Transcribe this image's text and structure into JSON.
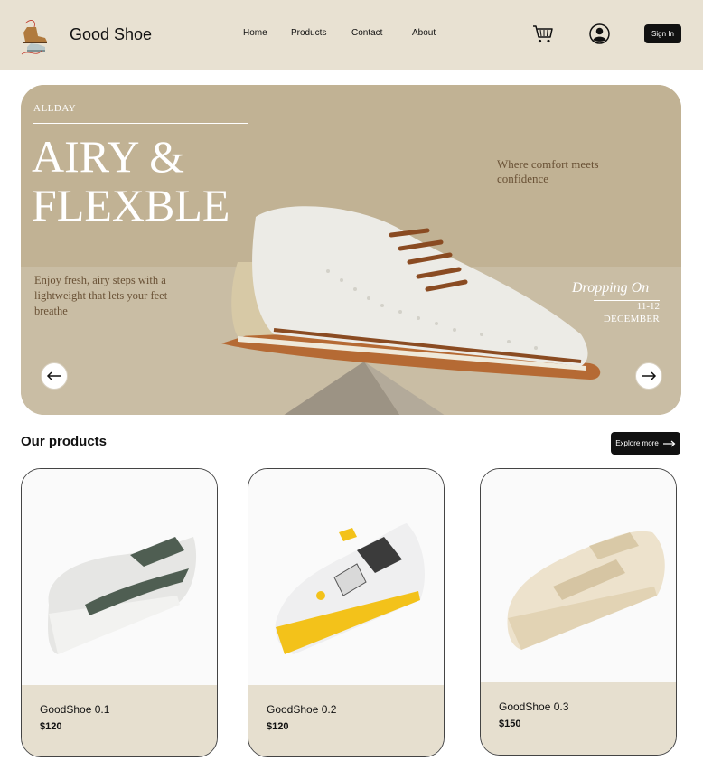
{
  "header": {
    "brand": "Good Shoe",
    "nav": [
      "Home",
      "Products",
      "Contact",
      "About"
    ],
    "signin_label": "Sign In"
  },
  "hero": {
    "eyebrow": "ALLDAY",
    "title_line1": "AIRY &",
    "title_line2": "FLEXBLE",
    "tagline": "Where comfort meets confidence",
    "description": "Enjoy fresh, airy steps with a lightweight that lets your feet breathe",
    "drop_label": "Dropping On",
    "drop_dates": "11-12",
    "drop_month": "DECEMBER"
  },
  "products": {
    "title": "Our products",
    "explore_label": "Explore more",
    "items": [
      {
        "name": "GoodShoe 0.1",
        "price": "$120"
      },
      {
        "name": "GoodShoe 0.2",
        "price": "$120"
      },
      {
        "name": "GoodShoe 0.3",
        "price": "$150"
      }
    ]
  },
  "colors": {
    "header_bg": "#e8e1d2",
    "hero_bg": "#c1b294",
    "card_info_bg": "#e6dfcf",
    "accent_text": "#6a5236"
  },
  "icons": [
    "shoe-logo-icon",
    "cart-icon",
    "user-icon",
    "arrow-left-icon",
    "arrow-right-icon"
  ]
}
